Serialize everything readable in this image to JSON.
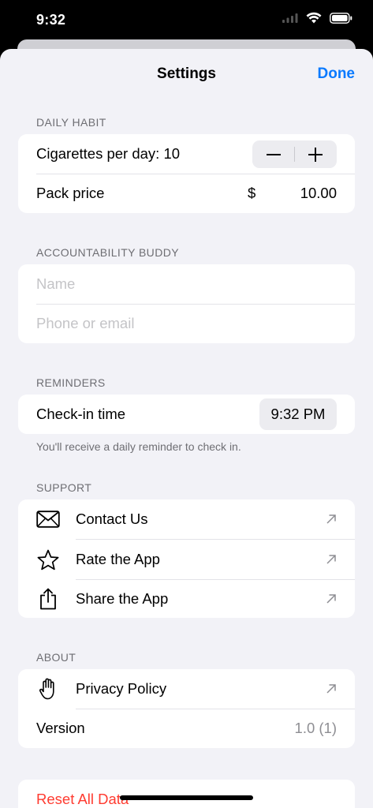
{
  "status": {
    "time": "9:32"
  },
  "nav": {
    "title": "Settings",
    "done": "Done"
  },
  "daily_habit": {
    "header": "DAILY HABIT",
    "cigs_label": "Cigarettes per day: 10",
    "minus": "−",
    "plus": "+",
    "pack_label": "Pack price",
    "currency": "$",
    "pack_value": "10.00"
  },
  "buddy": {
    "header": "ACCOUNTABILITY BUDDY",
    "name_placeholder": "Name",
    "contact_placeholder": "Phone or email"
  },
  "reminders": {
    "header": "REMINDERS",
    "checkin_label": "Check-in time",
    "checkin_time": "9:32 PM",
    "note": "You'll receive a daily reminder to check in."
  },
  "support": {
    "header": "SUPPORT",
    "items": [
      {
        "label": "Contact Us",
        "icon": "envelope-icon"
      },
      {
        "label": "Rate the App",
        "icon": "star-icon"
      },
      {
        "label": "Share the App",
        "icon": "share-icon"
      }
    ]
  },
  "about": {
    "header": "ABOUT",
    "privacy_label": "Privacy Policy",
    "privacy_icon": "hand-icon",
    "version_label": "Version",
    "version_value": "1.0 (1)"
  },
  "danger": {
    "reset_label": "Reset All Data"
  },
  "colors": {
    "accent": "#0a7aff",
    "destructive": "#ff3b30",
    "background": "#f2f2f7"
  }
}
